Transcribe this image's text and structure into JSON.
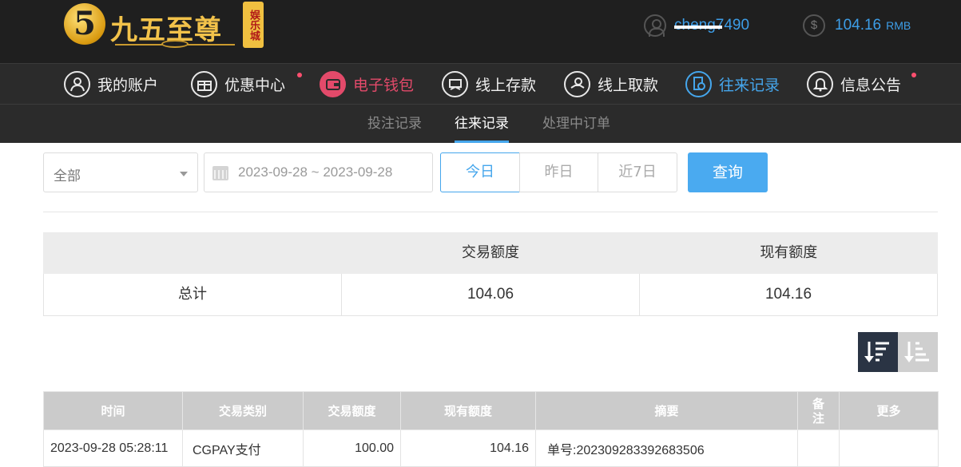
{
  "header": {
    "logo_numeral": "5",
    "logo_text": "九五至尊",
    "logo_sub": "娱乐城",
    "username": "cheng7490",
    "balance": "104.16",
    "balance_unit": "RMB"
  },
  "nav": {
    "items": [
      {
        "label": "我的账户",
        "icon": "user-icon"
      },
      {
        "label": "优惠中心",
        "icon": "gift-icon"
      },
      {
        "label": "电子钱包",
        "icon": "wallet-icon"
      },
      {
        "label": "线上存款",
        "icon": "deposit-icon"
      },
      {
        "label": "线上取款",
        "icon": "withdraw-icon"
      },
      {
        "label": "往来记录",
        "icon": "records-icon"
      },
      {
        "label": "信息公告",
        "icon": "bell-icon"
      }
    ]
  },
  "subnav": {
    "items": [
      "投注记录",
      "往来记录",
      "处理中订单"
    ]
  },
  "filter": {
    "type_selected": "全部",
    "date_range": "2023-09-28 ~ 2023-09-28",
    "today": "今日",
    "yesterday": "昨日",
    "last7": "近7日",
    "query": "查询"
  },
  "summary": {
    "headers": [
      "",
      "交易额度",
      "现有额度"
    ],
    "row_label": "总计",
    "trade_amount": "104.06",
    "current_amount": "104.16"
  },
  "detail": {
    "headers": [
      "时间",
      "交易类别",
      "交易额度",
      "现有额度",
      "摘要",
      "备注",
      "更多"
    ],
    "rows": [
      {
        "time": "2023-09-28 05:28:11",
        "type": "CGPAY支付",
        "amount": "100.00",
        "balance": "104.16",
        "summary": "单号:20230928339268​3506",
        "remark": "",
        "more": ""
      }
    ]
  },
  "colors": {
    "accent_blue": "#45a6ec",
    "wallet_pink": "#e34a6a",
    "gold": "#f2c24a"
  }
}
